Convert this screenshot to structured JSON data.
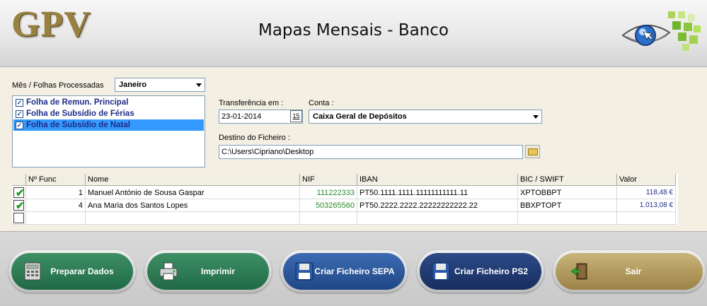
{
  "header": {
    "logo_text": "GPV",
    "title": "Mapas Mensais - Banco",
    "eye_logo_icon": "eye-logo-icon"
  },
  "options": {
    "mes_label": "Mês / Folhas Processadas",
    "mes_value": "Janeiro",
    "folhas": [
      {
        "label": "Folha de Remun. Principal",
        "checked": true,
        "selected": false
      },
      {
        "label": "Folha de Subsídio de Férias",
        "checked": true,
        "selected": false
      },
      {
        "label": "Folha de Subsídio de Natal",
        "checked": true,
        "selected": true
      }
    ],
    "transferencia_label": "Transferência em :",
    "transferencia_value": "23-01-2014",
    "calendar_btn": "15",
    "conta_label": "Conta :",
    "conta_value": "Caixa Geral de Depósitos",
    "destino_label": "Destino do Ficheiro :",
    "destino_value": "C:\\Users\\Cipriano\\Desktop"
  },
  "grid": {
    "columns": [
      "",
      "Nº Func",
      "Nome",
      "NIF",
      "IBAN",
      "BIC / SWIFT",
      "Valor"
    ],
    "rows": [
      {
        "checked": true,
        "func": "1",
        "nome": "Manuel António de Sousa Gaspar",
        "nif": "111222333",
        "iban": "PT50.1111.1111.11111111111.11",
        "bic": "XPTOBBPT",
        "valor": "118,48 €"
      },
      {
        "checked": true,
        "func": "4",
        "nome": "Ana Maria dos Santos Lopes",
        "nif": "503265560",
        "iban": "PT50.2222.2222.22222222222.22",
        "bic": "BBXPTOPT",
        "valor": "1.013,08 €"
      },
      {
        "checked": false,
        "func": "",
        "nome": "",
        "nif": "",
        "iban": "",
        "bic": "",
        "valor": ""
      }
    ]
  },
  "footer": {
    "preparar": "Preparar Dados",
    "imprimir": "Imprimir",
    "sepa": "Criar Ficheiro SEPA",
    "ps2": "Criar Ficheiro PS2",
    "sair": "Sair"
  },
  "colors": {
    "logo": "#9a8140",
    "nif_text": "#2b8a2b",
    "valor_text": "#1f2d87",
    "btn_green": "#2e7d56",
    "btn_blue": "#2f5a9e",
    "btn_navy": "#1f3a6e",
    "btn_tan": "#b39c5e"
  }
}
